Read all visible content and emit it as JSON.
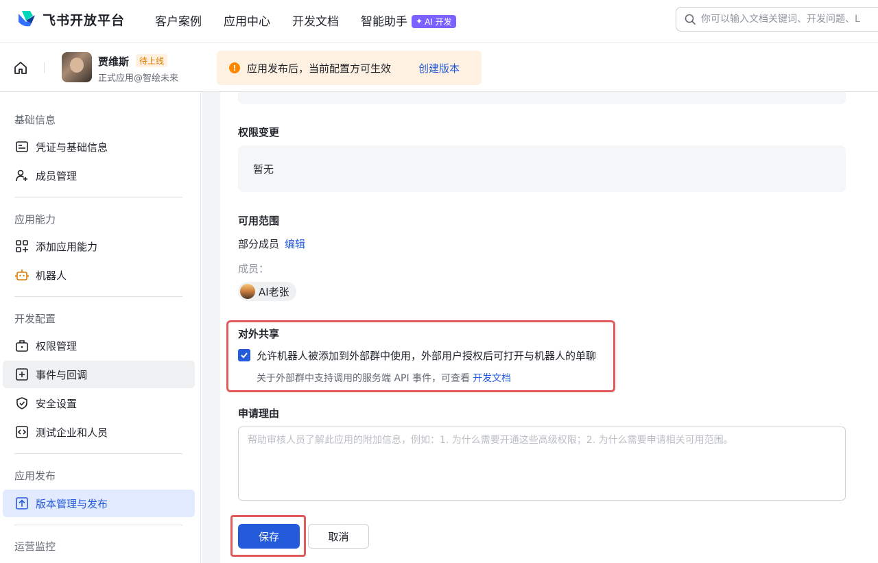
{
  "topnav": {
    "brand": "飞书开放平台",
    "links": [
      "客户案例",
      "应用中心",
      "开发文档",
      "智能助手"
    ],
    "ai_badge": "AI 开发",
    "search_placeholder": "你可以输入文档关键词、开发问题、L"
  },
  "appbar": {
    "app_name": "贾维斯",
    "status_badge": "待上线",
    "app_sub": "正式应用@智绘未来",
    "notice_text": "应用发布后，当前配置方可生效",
    "notice_link": "创建版本"
  },
  "sidebar": {
    "sections": [
      {
        "title": "基础信息",
        "items": [
          "凭证与基础信息",
          "成员管理"
        ]
      },
      {
        "title": "应用能力",
        "items": [
          "添加应用能力",
          "机器人"
        ]
      },
      {
        "title": "开发配置",
        "items": [
          "权限管理",
          "事件与回调",
          "安全设置",
          "测试企业和人员"
        ]
      },
      {
        "title": "应用发布",
        "items": [
          "版本管理与发布"
        ]
      },
      {
        "title": "运营监控",
        "items": []
      }
    ]
  },
  "main": {
    "perm_change_label": "权限变更",
    "perm_change_value": "暂无",
    "range_label": "可用范围",
    "range_value": "部分成员",
    "range_edit": "编辑",
    "members_label": "成员：",
    "member_chip": "AI老张",
    "share_title": "对外共享",
    "share_checkbox": "允许机器人被添加到外部群中使用，外部用户授权后可打开与机器人的单聊",
    "share_hint": "关于外部群中支持调用的服务端 API 事件，可查看",
    "share_hint_link": "开发文档",
    "reason_label": "申请理由",
    "reason_placeholder": "帮助审核人员了解此应用的附加信息，例如：1. 为什么需要开通这些高级权限；2. 为什么需要申请相关可用范围。",
    "save_label": "保存",
    "cancel_label": "取消"
  },
  "colors": {
    "accent": "#245bdb",
    "highlight_border": "#e05a5a",
    "ai_badge": "#7b61ff"
  }
}
